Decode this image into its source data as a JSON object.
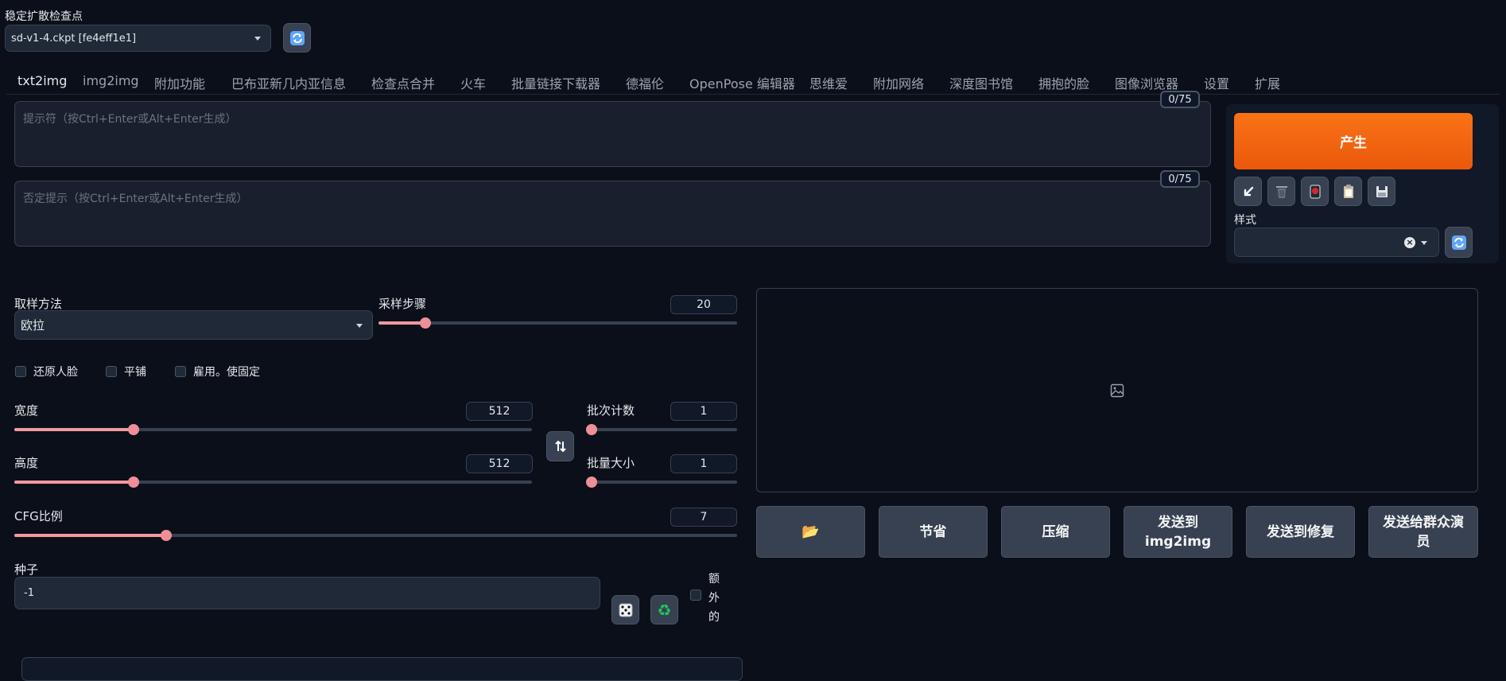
{
  "checkpoint": {
    "label": "稳定扩散检查点",
    "value": "sd-v1-4.ckpt [fe4eff1e1]",
    "refresh_icon": "refresh-icon"
  },
  "tabs": [
    "txt2img",
    "img2img",
    "附加功能",
    "巴布亚新几内亚信息",
    "检查点合并",
    "火车",
    "批量链接下载器",
    "德福伦",
    "OpenPose 编辑器",
    "思维爱",
    "附加网络",
    "深度图书馆",
    "拥抱的脸",
    "图像浏览器",
    "设置",
    "扩展"
  ],
  "prompt": {
    "placeholder": "提示符（按Ctrl+Enter或Alt+Enter生成）",
    "counter": "0/75"
  },
  "negative_prompt": {
    "placeholder": "否定提示（按Ctrl+Enter或Alt+Enter生成）",
    "counter": "0/75"
  },
  "generate": {
    "label": "产生",
    "color": "#ea580c"
  },
  "tool_icons": [
    "arrow-down-left-icon",
    "trash-icon",
    "red-card-icon",
    "clipboard-icon",
    "save-icon"
  ],
  "styles": {
    "label": "样式",
    "value": ""
  },
  "sampler": {
    "label": "取样方法",
    "value": "欧拉"
  },
  "steps": {
    "label": "采样步骤",
    "value": "20",
    "fraction": 0.13
  },
  "checkboxes": {
    "restore_faces": "还原人脸",
    "tiling": "平铺",
    "hires_fix": "雇用。使固定",
    "extra": [
      "额",
      "外",
      "的"
    ]
  },
  "width": {
    "label": "宽度",
    "value": "512",
    "fraction": 0.23
  },
  "height": {
    "label": "高度",
    "value": "512",
    "fraction": 0.23
  },
  "batch_count": {
    "label": "批次计数",
    "value": "1",
    "fraction": 0.0
  },
  "batch_size": {
    "label": "批量大小",
    "value": "1",
    "fraction": 0.0
  },
  "cfg": {
    "label": "CFG比例",
    "value": "7",
    "fraction": 0.21
  },
  "seed": {
    "label": "种子",
    "value": "-1"
  },
  "output_buttons": {
    "folder_icon": "folder-icon",
    "save": "节省",
    "zip": "压缩",
    "send_img2img": "发送到img2img",
    "send_inpaint": "发送到修复",
    "send_extras": "发送给群众演员"
  }
}
